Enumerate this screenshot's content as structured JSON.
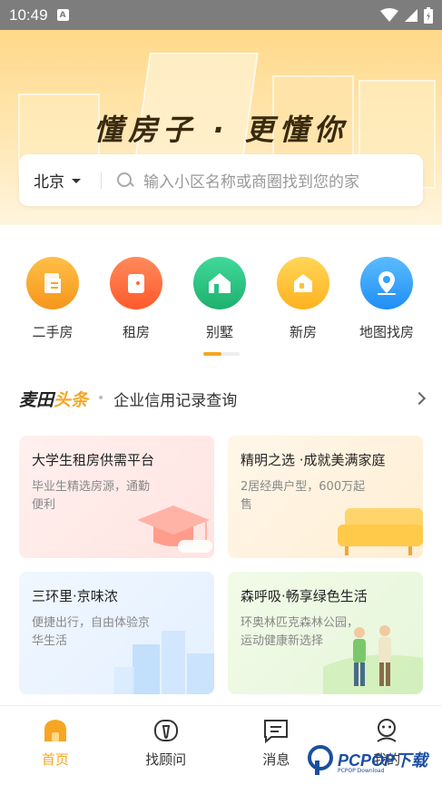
{
  "status_bar": {
    "time": "10:49",
    "sim_label": "A"
  },
  "hero": {
    "slogan": "懂房子 · 更懂你"
  },
  "search": {
    "city": "北京",
    "placeholder": "输入小区名称或商圈找到您的家"
  },
  "categories": [
    {
      "label": "二手房",
      "icon": "second-hand-house-icon",
      "color": "#f6a623"
    },
    {
      "label": "租房",
      "icon": "rent-icon",
      "color": "#ff6b3d"
    },
    {
      "label": "别墅",
      "icon": "villa-icon",
      "color": "#26c281"
    },
    {
      "label": "新房",
      "icon": "new-house-icon",
      "color": "#ffc233"
    },
    {
      "label": "地图找房",
      "icon": "map-pin-icon",
      "color": "#2fa3ff"
    }
  ],
  "news": {
    "brand_1": "麦田",
    "brand_2": "头条",
    "headline": "企业信用记录查询"
  },
  "cards": [
    {
      "title": "大学生租房供需平台",
      "subtitle": "毕业生精选房源，通勤便利"
    },
    {
      "title": "精明之选 ·成就美满家庭",
      "subtitle": "2居经典户型，600万起售"
    },
    {
      "title": "三环里·京味浓",
      "subtitle": "便捷出行，自由体验京华生活"
    },
    {
      "title": "森呼吸·畅享绿色生活",
      "subtitle": "环奥林匹克森林公园，运动健康新选择"
    }
  ],
  "tabs": [
    {
      "label": "首页",
      "icon": "home-icon",
      "active": true
    },
    {
      "label": "找顾问",
      "icon": "advisor-icon",
      "active": false
    },
    {
      "label": "消息",
      "icon": "message-icon",
      "active": false
    },
    {
      "label": "我的",
      "icon": "profile-icon",
      "active": false
    }
  ],
  "watermark": {
    "text": "PCPOP下载",
    "small": "PCPOP Download"
  },
  "colors": {
    "accent": "#f6a623"
  }
}
